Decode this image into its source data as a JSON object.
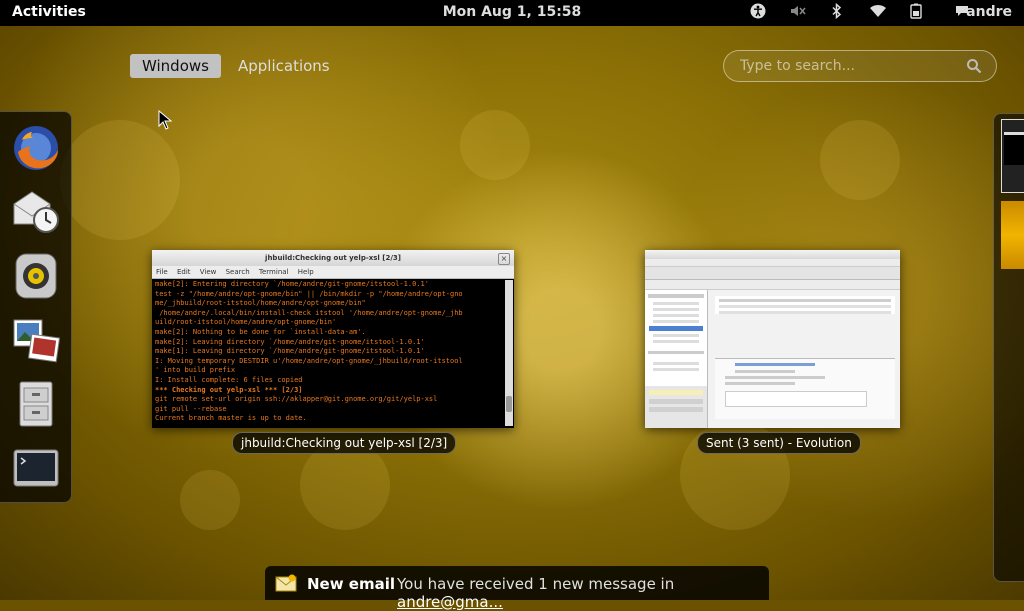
{
  "top_bar": {
    "activities": "Activities",
    "clock": "Mon Aug  1, 15:58",
    "user": "andre"
  },
  "overview": {
    "tabs": [
      {
        "label": "Windows"
      },
      {
        "label": "Applications"
      }
    ],
    "search": {
      "placeholder": "Type to search..."
    }
  },
  "dash": {
    "items": [
      "firefox-icon",
      "evolution-icon",
      "rhythmbox-icon",
      "image-viewer-icon",
      "file-manager-icon",
      "terminal-icon"
    ]
  },
  "windows": [
    {
      "title": "jhbuild:Checking out yelp-xsl [2/3]",
      "caption": "jhbuild:Checking out yelp-xsl [2/3]",
      "menu": [
        "File",
        "Edit",
        "View",
        "Search",
        "Terminal",
        "Help"
      ],
      "lines": [
        "make[2]: Entering directory `/home/andre/git-gnome/itstool-1.0.1'",
        "test -z \"/home/andre/opt-gnome/bin\" || /bin/mkdir -p \"/home/andre/opt-gno",
        "me/_jhbuild/root-itstool/home/andre/opt-gnome/bin\"",
        " /home/andre/.local/bin/install-check itstool '/home/andre/opt-gnome/_jhb",
        "uild/root-itstool/home/andre/opt-gnome/bin'",
        "make[2]: Nothing to be done for `install-data-am'.",
        "make[2]: Leaving directory `/home/andre/git-gnome/itstool-1.0.1'",
        "make[1]: Leaving directory `/home/andre/git-gnome/itstool-1.0.1'",
        "I: Moving temporary DESTDIR u'/home/andre/opt-gnome/_jhbuild/root-itstool",
        "' into build prefix",
        "I: Install complete: 6 files copied",
        "*** Checking out yelp-xsl *** [2/3]",
        "git remote set-url origin ssh://aklapper@git.gnome.org/git/yelp-xsl",
        "git pull --rebase",
        "Current branch master is up to date."
      ]
    },
    {
      "caption": "Sent (3 sent) - Evolution"
    }
  ],
  "notification": {
    "title": "New email",
    "body": "You have received 1 new message  in ",
    "link": "andre@gma..."
  }
}
